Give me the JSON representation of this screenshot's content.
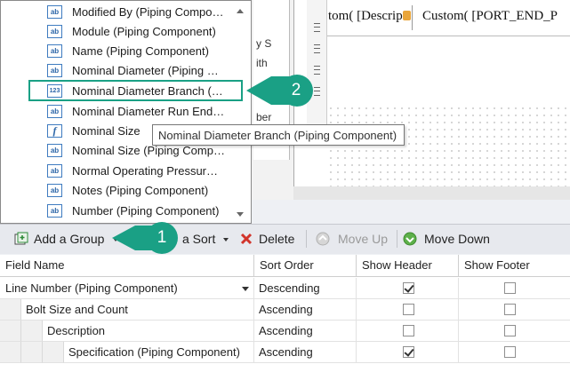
{
  "dropdown": {
    "items": [
      {
        "label": "Modified By (Piping Compo…",
        "icon": "ab"
      },
      {
        "label": "Module (Piping Component)",
        "icon": "ab"
      },
      {
        "label": "Name (Piping Component)",
        "icon": "ab"
      },
      {
        "label": "Nominal Diameter (Piping …",
        "icon": "ab"
      },
      {
        "label": "Nominal Diameter Branch (…",
        "icon": "123"
      },
      {
        "label": "Nominal Diameter Run End…",
        "icon": "ab"
      },
      {
        "label": "Nominal Size",
        "icon": "f"
      },
      {
        "label": "Nominal Size (Piping Comp…",
        "icon": "ab"
      },
      {
        "label": "Normal Operating Pressur…",
        "icon": "ab"
      },
      {
        "label": "Notes (Piping Component)",
        "icon": "ab"
      },
      {
        "label": "Number (Piping Component)",
        "icon": "ab"
      }
    ]
  },
  "tooltip": {
    "text": "Nominal Diameter Branch (Piping Component)"
  },
  "callouts": {
    "one": "1",
    "two": "2"
  },
  "background": {
    "side_texts": [
      "y S",
      "ith",
      "ber"
    ],
    "header_cells": [
      "tom( [Descrip",
      "Custom( [PORT_END_P"
    ]
  },
  "toolbar": {
    "add_group": "Add a Group",
    "add_sort": "a Sort",
    "delete": "Delete",
    "move_up": "Move Up",
    "move_down": "Move Down"
  },
  "table": {
    "columns": [
      "Field Name",
      "Sort Order",
      "Show Header",
      "Show Footer"
    ],
    "rows": [
      {
        "field": "Line Number (Piping Component)",
        "sort": "Descending",
        "show_header": true,
        "show_footer": false
      },
      {
        "field": "Bolt Size and Count",
        "sort": "Ascending",
        "show_header": false,
        "show_footer": false
      },
      {
        "field": "Description",
        "sort": "Ascending",
        "show_header": false,
        "show_footer": false
      },
      {
        "field": "Specification (Piping Component)",
        "sort": "Ascending",
        "show_header": true,
        "show_footer": false
      }
    ]
  },
  "colors": {
    "accent": "#1aa085",
    "toolbar_bg": "#e7e9ee"
  }
}
